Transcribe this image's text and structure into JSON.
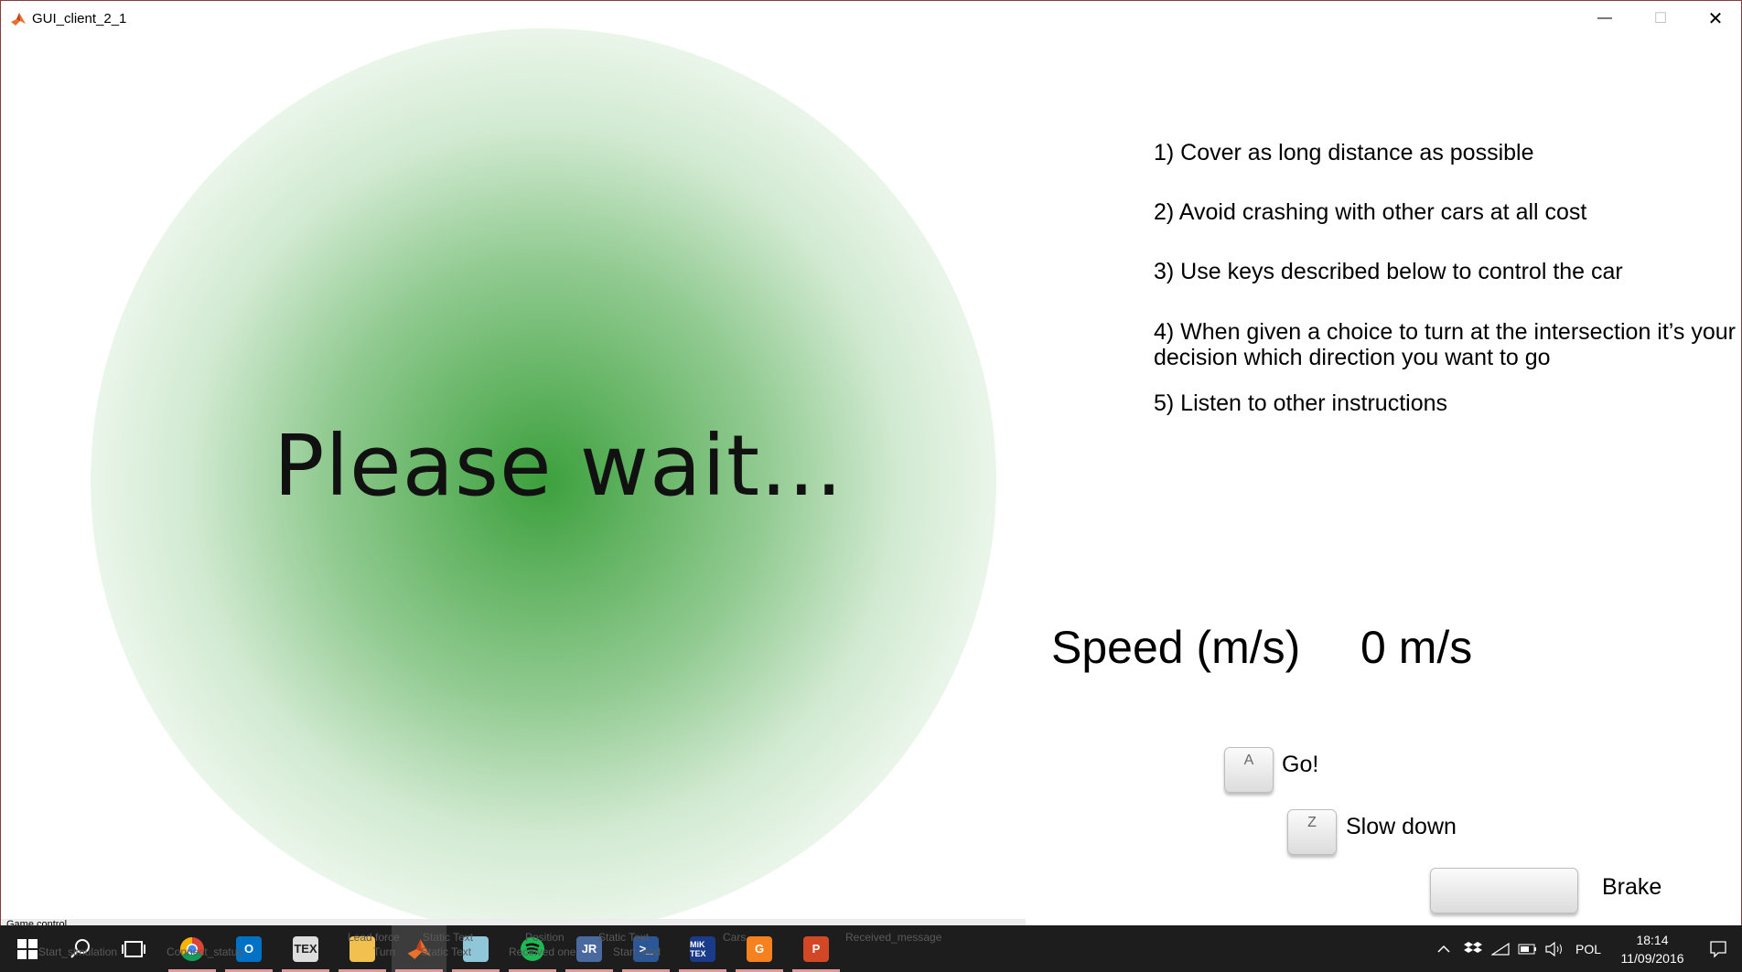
{
  "window": {
    "title": "GUI_client_2_1",
    "minimize_glyph": "—",
    "maximize_glyph": "☐",
    "close_glyph": "✕"
  },
  "main": {
    "wait_message": "Please wait...",
    "indicator_color": "#4caf50"
  },
  "instructions": [
    "1) Cover as long distance as possible",
    "2) Avoid crashing with other cars at all cost",
    "3) Use keys described below to control the car",
    "4) When given a choice to turn at the intersection it’s your",
    "decision which direction you want to go",
    "5) Listen to other instructions"
  ],
  "speed": {
    "label": "Speed (m/s)",
    "value": "0 m/s"
  },
  "controls": [
    {
      "key": "A",
      "action": "Go!"
    },
    {
      "key": "Z",
      "action": "Slow down"
    },
    {
      "key": "",
      "action": "Brake"
    }
  ],
  "status": {
    "panel_label": "Game control"
  },
  "taskbar": {
    "apps": [
      "start-icon",
      "search-icon",
      "task-view-icon",
      "chrome-icon",
      "outlook-icon",
      "tex-icon",
      "file-explorer-icon",
      "matlab-icon",
      "notes-icon",
      "spotify-icon",
      "jabref-icon",
      "powershell-icon",
      "miktex-icon",
      "foxit-icon",
      "powerpoint-icon"
    ],
    "ghost_labels": {
      "start_simulation": "Start_simulation",
      "connect_status": "Connect_status",
      "lead_force": "Lead force",
      "turn": "Turn",
      "static_text_1": "Static Text",
      "static_text_2": "Static Text",
      "position": "Position",
      "received_one": "Received one",
      "static_text_3": "Static Text",
      "start_end": "Start_end",
      "cars": "Cars",
      "received_message": "Received_message"
    },
    "tray": {
      "language": "POL",
      "time": "18:14",
      "date": "11/09/2016"
    }
  }
}
